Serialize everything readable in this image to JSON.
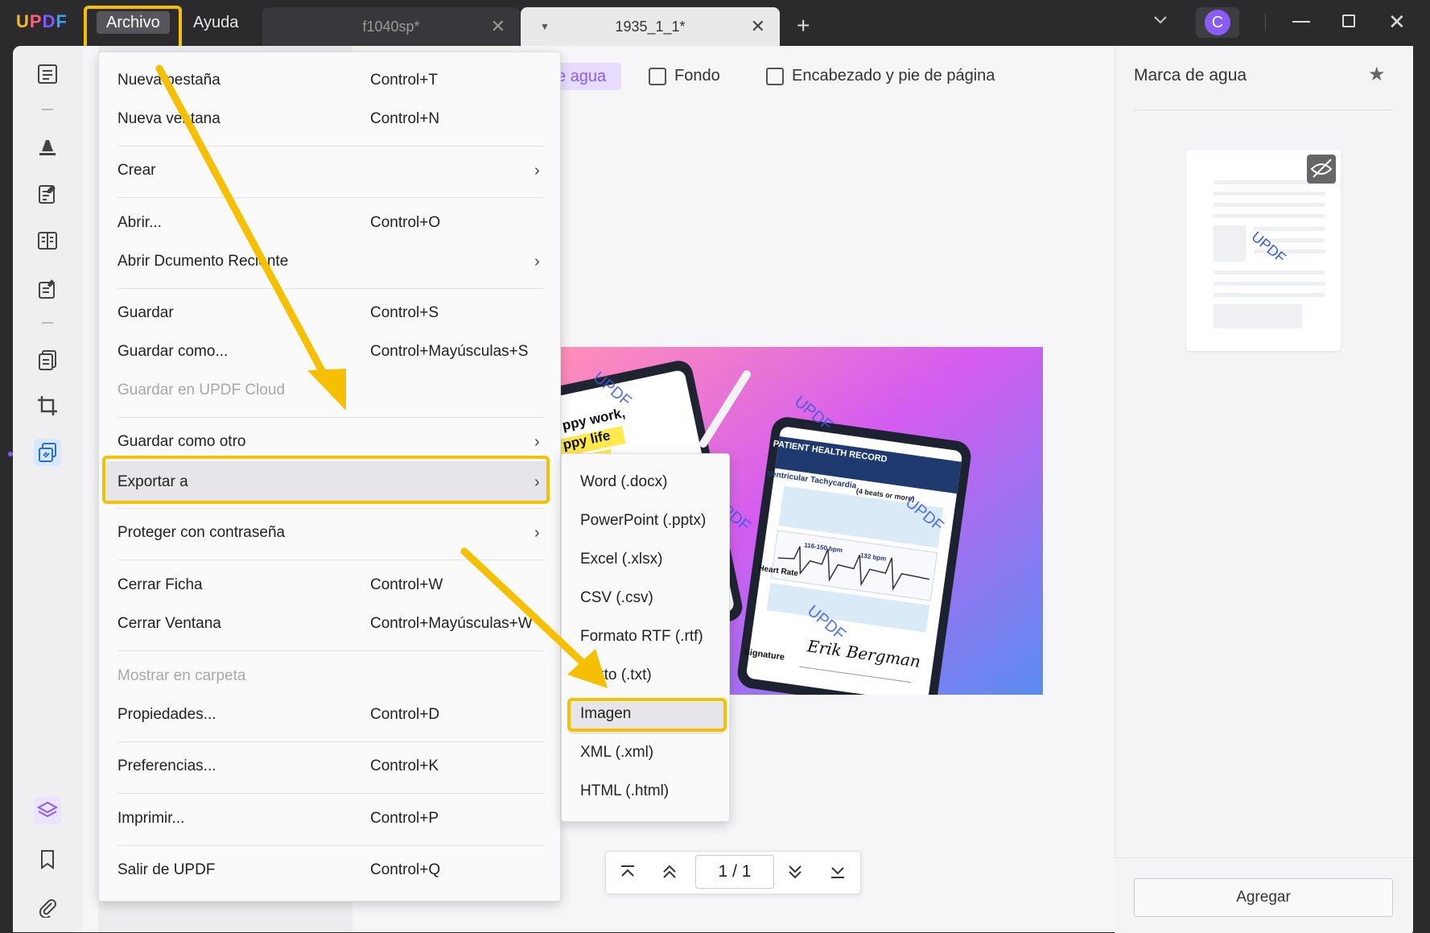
{
  "app": {
    "logo": "UPDF",
    "menubar": [
      "Archivo",
      "Ayuda"
    ],
    "tabs": [
      {
        "label": "f1040sp*"
      },
      {
        "label": "1935_1_1*"
      }
    ],
    "avatar_letter": "C"
  },
  "toolbar": {
    "watermark_chip": "e agua",
    "fondo": "Fondo",
    "header_footer": "Encabezado y pie de página"
  },
  "file_menu": {
    "items": [
      {
        "label": "Nueva pestaña",
        "shortcut": "Control+T"
      },
      {
        "label": "Nueva ventana",
        "shortcut": "Control+N"
      },
      {
        "label": "Crear",
        "shortcut": ""
      },
      {
        "label": "Abrir...",
        "shortcut": "Control+O"
      },
      {
        "label": "Abrir Dcumento Reciente",
        "shortcut": ""
      },
      {
        "label": "Guardar",
        "shortcut": "Control+S"
      },
      {
        "label": "Guardar como...",
        "shortcut": "Control+Mayúsculas+S"
      },
      {
        "label": "Guardar en UPDF Cloud",
        "shortcut": ""
      },
      {
        "label": "Guardar como otro",
        "shortcut": ""
      },
      {
        "label": "Exportar a",
        "shortcut": ""
      },
      {
        "label": "Proteger con contraseña",
        "shortcut": ""
      },
      {
        "label": "Cerrar Ficha",
        "shortcut": "Control+W"
      },
      {
        "label": "Cerrar Ventana",
        "shortcut": "Control+Mayúsculas+W"
      },
      {
        "label": "Mostrar en carpeta",
        "shortcut": ""
      },
      {
        "label": "Propiedades...",
        "shortcut": "Control+D"
      },
      {
        "label": "Preferencias...",
        "shortcut": "Control+K"
      },
      {
        "label": "Imprimir...",
        "shortcut": "Control+P"
      },
      {
        "label": "Salir de UPDF",
        "shortcut": "Control+Q"
      }
    ]
  },
  "export_submenu": {
    "items": [
      "Word (.docx)",
      "PowerPoint (.pptx)",
      "Excel (.xlsx)",
      "CSV (.csv)",
      "Formato RTF (.rtf)",
      "Texto (.txt)",
      "Imagen",
      "XML (.xml)",
      "HTML (.html)"
    ]
  },
  "right_panel": {
    "title": "Marca de agua",
    "add_button": "Agregar",
    "thumb_watermark": "UPDF"
  },
  "document": {
    "watermark_text": "UPDF",
    "record_title": "PATIENT HEALTH RECORD",
    "condition": "Ventricular Tachycardia",
    "condition_note": "(4 beats or more)",
    "heart_rate": "Heart Rate",
    "signature_label": "Signature",
    "signature_name": "Erik Bergman",
    "tablet2_line1": "ppy work,",
    "tablet2_line2": "ppy life",
    "hr_range": "116-150 bpm",
    "hr_avg": "132 bpm"
  },
  "page_nav": {
    "current": "1",
    "sep": "/",
    "total": "1"
  },
  "colors": {
    "accent": "#8a5cf6",
    "highlight": "#f6c000",
    "titlebar": "#2b2b2e"
  }
}
